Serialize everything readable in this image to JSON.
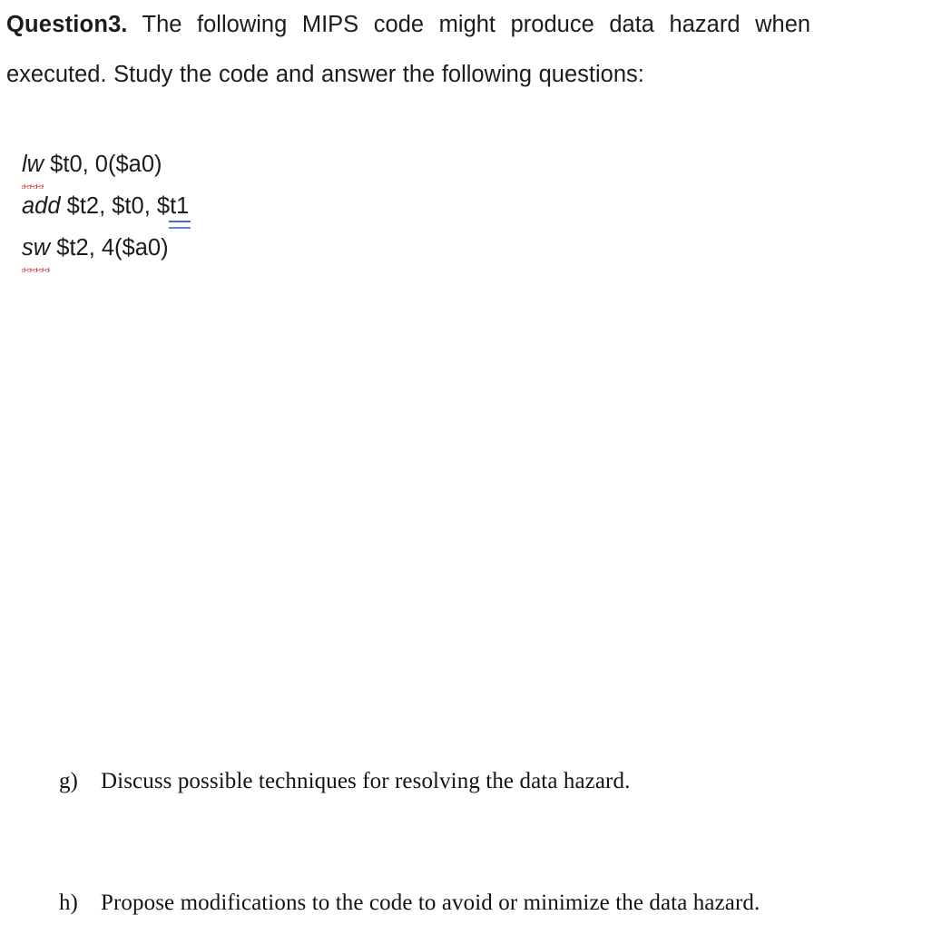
{
  "document": {
    "background_color": "#ffffff",
    "question": {
      "label": "Question",
      "number": "3.",
      "line1_rest": "The following MIPS code might produce data hazard when",
      "line2": "executed. Study the code and answer the following questions:"
    },
    "code_block": {
      "language": "MIPS",
      "lines": [
        {
          "mnemonic": "lw",
          "operands": " $t0, 0($a0)",
          "mnemonic_marking": "spelling-error",
          "operand_marking": "none"
        },
        {
          "mnemonic": "add",
          "operands_before": " $t2, $t0, $",
          "operands_marked": "t1",
          "operands_after": "",
          "mnemonic_marking": "none",
          "operand_marking": "grammar-suggestion"
        },
        {
          "mnemonic": "sw",
          "operands": " $t2, 4($a0)",
          "mnemonic_marking": "spelling-error",
          "operand_marking": "none"
        }
      ],
      "spelling_underline_color": "#cc3b33",
      "grammar_underline_color": "#4a6fd0"
    },
    "sub_questions": [
      {
        "marker": "g)",
        "text": "Discuss possible techniques for resolving the data hazard."
      },
      {
        "marker": "h)",
        "text": "Propose modifications to the code to avoid or minimize the data hazard."
      }
    ]
  }
}
